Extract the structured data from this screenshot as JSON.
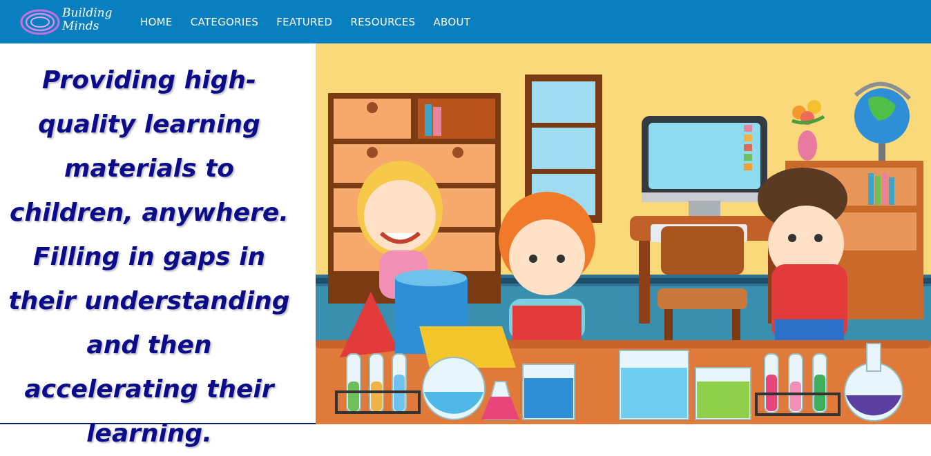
{
  "header": {
    "logo_line1": "Building",
    "logo_line2": "Minds",
    "nav": [
      "HOME",
      "CATEGORIES",
      "FEATURED",
      "RESOURCES",
      "ABOUT"
    ]
  },
  "hero": {
    "tagline": "Providing high-quality learning materials to children, anywhere. Filling in gaps in their understanding and then accelerating their learning."
  },
  "colors": {
    "header_bg": "#0a7fbf",
    "tagline": "#0c0c8a"
  }
}
